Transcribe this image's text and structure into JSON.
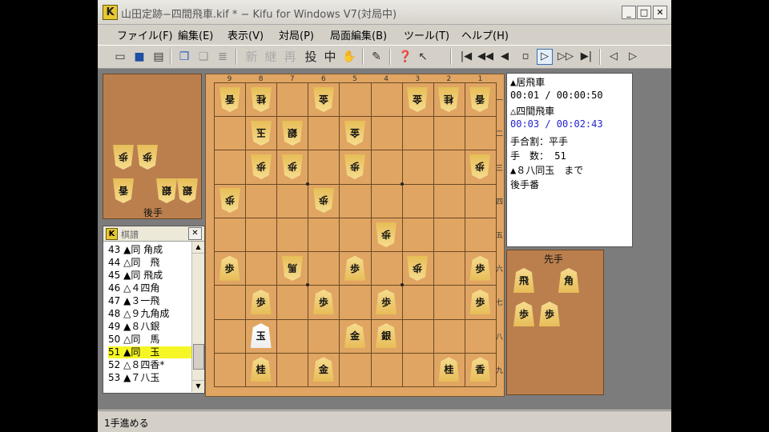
{
  "window": {
    "title": "山田定跡−四間飛車.kif * − Kifu for Windows V7(対局中)",
    "min_glyph": "_",
    "max_glyph": "□",
    "close_glyph": "✕"
  },
  "menu": [
    {
      "label": "ファイル(F)"
    },
    {
      "label": "編集(E)"
    },
    {
      "label": "表示(V)"
    },
    {
      "label": "対局(P)"
    },
    {
      "label": "局面編集(B)"
    },
    {
      "label": "ツール(T)"
    },
    {
      "label": "ヘルプ(H)"
    }
  ],
  "toolbar": {
    "kanji": [
      "新",
      "継",
      "再",
      "投",
      "中"
    ],
    "nav": [
      "|◀",
      "◀◀",
      "◀",
      "▫",
      "▷",
      "▷▷",
      "▶|",
      "◁",
      "▷"
    ]
  },
  "gote_hand": {
    "label": "後手",
    "pieces": [
      "歩",
      "歩",
      "香",
      "銀",
      "銀"
    ]
  },
  "sente_hand": {
    "label": "先手",
    "pieces": [
      "飛",
      "角",
      "歩",
      "歩"
    ]
  },
  "board": {
    "file_labels": [
      "9",
      "8",
      "7",
      "6",
      "5",
      "4",
      "3",
      "2",
      "1"
    ],
    "rank_labels": [
      "一",
      "二",
      "三",
      "四",
      "五",
      "六",
      "七",
      "八",
      "九"
    ],
    "pieces": [
      {
        "file": 9,
        "rank": 1,
        "piece": "香",
        "owner": "gote"
      },
      {
        "file": 8,
        "rank": 1,
        "piece": "桂",
        "owner": "gote"
      },
      {
        "file": 6,
        "rank": 1,
        "piece": "金",
        "owner": "gote"
      },
      {
        "file": 3,
        "rank": 1,
        "piece": "金",
        "owner": "gote"
      },
      {
        "file": 2,
        "rank": 1,
        "piece": "桂",
        "owner": "gote"
      },
      {
        "file": 1,
        "rank": 1,
        "piece": "香",
        "owner": "gote"
      },
      {
        "file": 8,
        "rank": 2,
        "piece": "玉",
        "owner": "gote"
      },
      {
        "file": 7,
        "rank": 2,
        "piece": "銀",
        "owner": "gote"
      },
      {
        "file": 5,
        "rank": 2,
        "piece": "金",
        "owner": "gote"
      },
      {
        "file": 8,
        "rank": 3,
        "piece": "歩",
        "owner": "gote"
      },
      {
        "file": 7,
        "rank": 3,
        "piece": "歩",
        "owner": "gote"
      },
      {
        "file": 5,
        "rank": 3,
        "piece": "歩",
        "owner": "gote"
      },
      {
        "file": 1,
        "rank": 3,
        "piece": "歩",
        "owner": "gote"
      },
      {
        "file": 9,
        "rank": 4,
        "piece": "歩",
        "owner": "gote"
      },
      {
        "file": 6,
        "rank": 4,
        "piece": "歩",
        "owner": "gote"
      },
      {
        "file": 4,
        "rank": 5,
        "piece": "歩",
        "owner": "gote"
      },
      {
        "file": 7,
        "rank": 6,
        "piece": "馬",
        "owner": "gote"
      },
      {
        "file": 3,
        "rank": 6,
        "piece": "歩",
        "owner": "gote"
      },
      {
        "file": 9,
        "rank": 6,
        "piece": "歩",
        "owner": "sente"
      },
      {
        "file": 5,
        "rank": 6,
        "piece": "歩",
        "owner": "sente"
      },
      {
        "file": 1,
        "rank": 6,
        "piece": "歩",
        "owner": "sente"
      },
      {
        "file": 8,
        "rank": 7,
        "piece": "歩",
        "owner": "sente"
      },
      {
        "file": 6,
        "rank": 7,
        "piece": "歩",
        "owner": "sente"
      },
      {
        "file": 4,
        "rank": 7,
        "piece": "歩",
        "owner": "sente"
      },
      {
        "file": 1,
        "rank": 7,
        "piece": "歩",
        "owner": "sente"
      },
      {
        "file": 8,
        "rank": 8,
        "piece": "玉",
        "owner": "sente",
        "highlight": true
      },
      {
        "file": 5,
        "rank": 8,
        "piece": "金",
        "owner": "sente"
      },
      {
        "file": 4,
        "rank": 8,
        "piece": "銀",
        "owner": "sente"
      },
      {
        "file": 8,
        "rank": 9,
        "piece": "桂",
        "owner": "sente"
      },
      {
        "file": 6,
        "rank": 9,
        "piece": "金",
        "owner": "sente"
      },
      {
        "file": 2,
        "rank": 9,
        "piece": "桂",
        "owner": "sente"
      },
      {
        "file": 1,
        "rank": 9,
        "piece": "香",
        "owner": "sente"
      }
    ]
  },
  "info": {
    "sente_name": "▲居飛車",
    "sente_time": "00:01 / 00:00:50",
    "gote_name": "△四間飛車",
    "gote_time": "00:03 / 00:02:43",
    "handicap": "手合割：平手",
    "moves": "手　数： 51",
    "last_move": "▲８八同玉　まで",
    "turn": "後手番",
    "blue": "#2222cc"
  },
  "kifu": {
    "title": "棋譜",
    "close_glyph": "✕",
    "rows": [
      "43 ▲同 角成",
      "44 △同　飛",
      "45 ▲同 飛成",
      "46 △４四角",
      "47 ▲３一飛",
      "48 △９九角成",
      "49 ▲８八銀",
      "50 △同　馬",
      "51 ▲同　玉",
      "52 △８四香*",
      "53 ▲７八玉"
    ],
    "selected_index": 8,
    "selected_color": "#f6f626"
  },
  "status": {
    "text": "1手進める"
  }
}
